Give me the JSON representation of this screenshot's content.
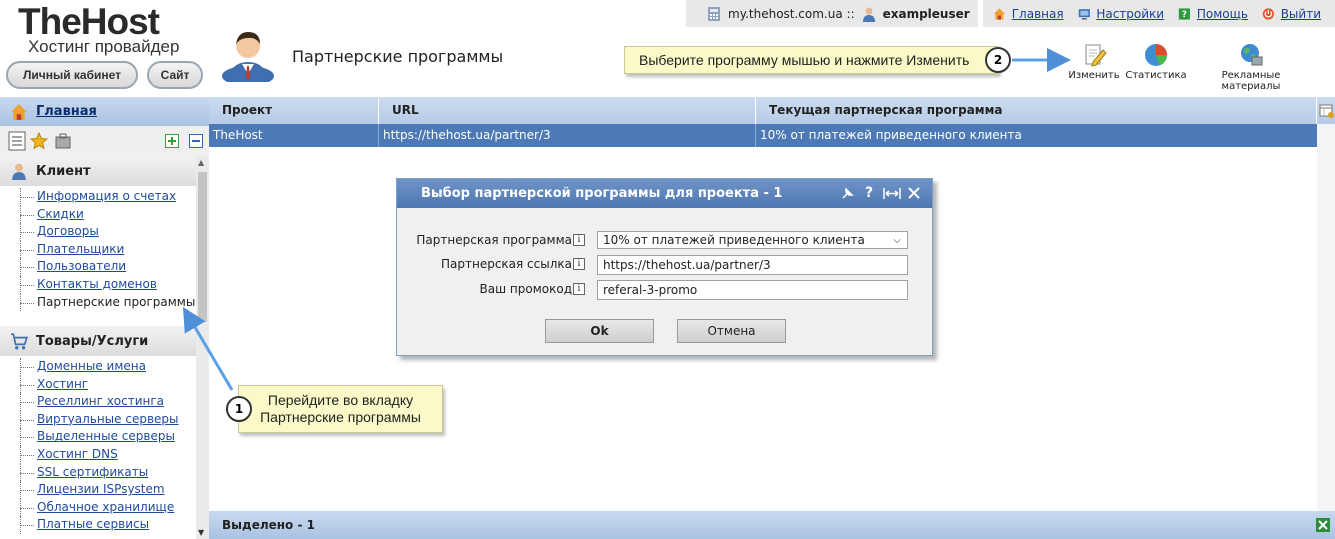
{
  "header": {
    "logo_main": "TheHost",
    "logo_sub": "Хостинг провайдер",
    "cabinet_button": "Личный кабинет",
    "site_button": "Сайт",
    "page_title": "Партнерские программы"
  },
  "topbar": {
    "host": "my.thehost.com.ua ::",
    "user": "exampleuser",
    "nav": [
      {
        "label": "Главная",
        "icon": "home-icon"
      },
      {
        "label": "Настройки",
        "icon": "settings-icon"
      },
      {
        "label": "Помощь",
        "icon": "help-icon"
      },
      {
        "label": "Выйти",
        "icon": "power-icon"
      }
    ]
  },
  "toolbar": {
    "edit": "Изменить",
    "stats": "Статистика",
    "ads": "Рекламные материалы"
  },
  "hints": {
    "hint1_num": "1",
    "hint1_text": "Перейдите во вкладку Партнерские программы",
    "hint2_num": "2",
    "hint2_text": "Выберите программу мышью и нажмите Изменить"
  },
  "sidebar": {
    "home": "Главная",
    "sections": [
      {
        "title": "Клиент",
        "items": [
          "Информация о счетах",
          "Скидки",
          "Договоры",
          "Плательщики",
          "Пользователи",
          "Контакты доменов",
          "Партнерские программы"
        ]
      },
      {
        "title": "Товары/Услуги",
        "items": [
          "Доменные имена",
          "Хостинг",
          "Реселлинг хостинга",
          "Виртуальные серверы",
          "Выделенные серверы",
          "Хостинг DNS",
          "SSL сертификаты",
          "Лицензии ISPsystem",
          "Облачное хранилище",
          "Платные сервисы"
        ]
      }
    ]
  },
  "grid": {
    "columns": [
      "Проект",
      "URL",
      "Текущая партнерская программа"
    ],
    "rows": [
      [
        "TheHost",
        "https://thehost.ua/partner/3",
        "10% от платежей приведенного клиента"
      ]
    ],
    "footer": "Выделено - 1"
  },
  "dialog": {
    "title": "Выбор партнерской программы для проекта - 1",
    "fields": {
      "program_label": "Партнерская программа",
      "program_value": "10% от платежей приведенного клиента",
      "link_label": "Партнерская ссылка",
      "link_value": "https://thehost.ua/partner/3",
      "promo_label": "Ваш промокод",
      "promo_value": "referal-3-promo"
    },
    "ok": "Ok",
    "cancel": "Отмена"
  }
}
